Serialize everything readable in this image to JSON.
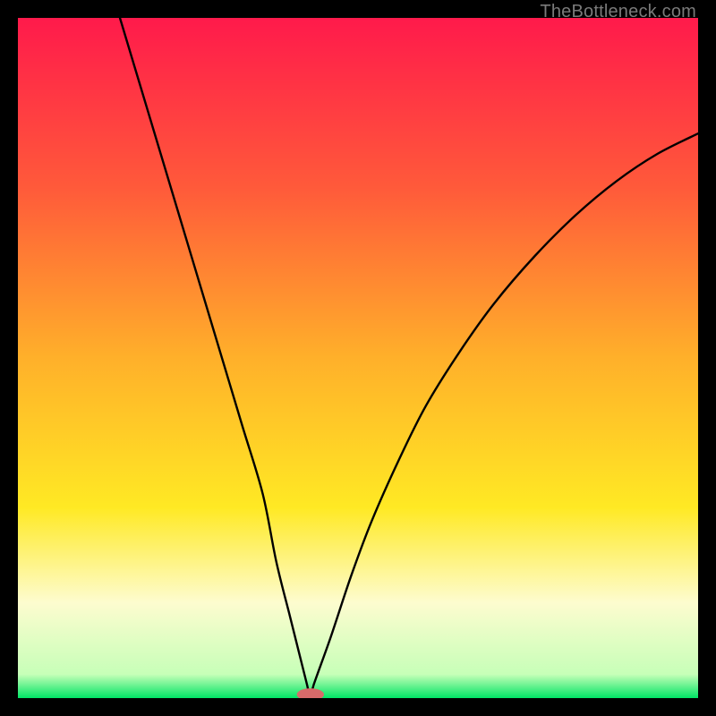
{
  "watermark": "TheBottleneck.com",
  "chart_data": {
    "type": "line",
    "title": "",
    "xlabel": "",
    "ylabel": "",
    "xlim": [
      0,
      100
    ],
    "ylim": [
      0,
      100
    ],
    "grid": false,
    "legend": false,
    "background_gradient": {
      "stops": [
        {
          "offset": 0.0,
          "color": "#ff1a4b"
        },
        {
          "offset": 0.25,
          "color": "#ff5a3a"
        },
        {
          "offset": 0.5,
          "color": "#ffb02a"
        },
        {
          "offset": 0.72,
          "color": "#ffe924"
        },
        {
          "offset": 0.86,
          "color": "#fdfccf"
        },
        {
          "offset": 0.965,
          "color": "#c7ffb8"
        },
        {
          "offset": 1.0,
          "color": "#00e565"
        }
      ]
    },
    "series": [
      {
        "name": "bottleneck-curve",
        "color": "#000000",
        "x": [
          15,
          18,
          21,
          24,
          27,
          30,
          33,
          36,
          38,
          40,
          41.5,
          42.5,
          43,
          43.5,
          46,
          49,
          52,
          56,
          60,
          65,
          70,
          76,
          82,
          88,
          94,
          100
        ],
        "y": [
          100,
          90,
          80,
          70,
          60,
          50,
          40,
          30,
          20,
          12,
          6,
          2,
          0,
          2,
          9,
          18,
          26,
          35,
          43,
          51,
          58,
          65,
          71,
          76,
          80,
          83
        ]
      }
    ],
    "marker": {
      "name": "optimal-marker",
      "color": "#d76a6a",
      "x": 43,
      "y": 0,
      "rx": 2.0,
      "ry": 0.9
    }
  }
}
